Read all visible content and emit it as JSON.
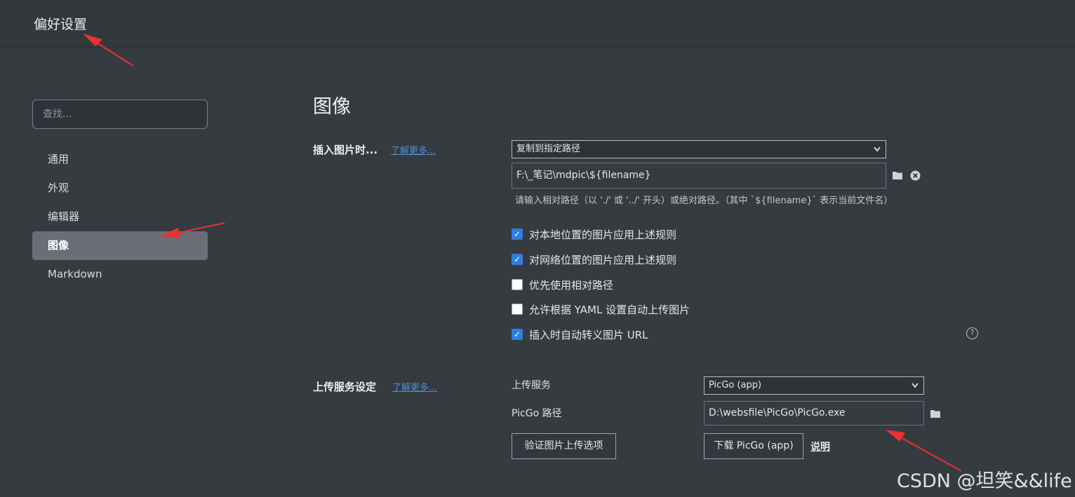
{
  "window": {
    "title": "偏好设置"
  },
  "sidebar": {
    "search_placeholder": "查找...",
    "items": [
      {
        "label": "通用",
        "active": false
      },
      {
        "label": "外观",
        "active": false
      },
      {
        "label": "编辑器",
        "active": false
      },
      {
        "label": "图像",
        "active": true
      },
      {
        "label": "Markdown",
        "active": false
      }
    ]
  },
  "main": {
    "title": "图像",
    "insert_section": {
      "label": "插入图片时...",
      "learn_more": "了解更多...",
      "select_value": "复制到指定路径",
      "path_value": "F:\\_笔记\\mdpic\\${filename}",
      "hint": "请输入相对路径（以 './' 或 '../' 开头）或绝对路径。（其中 `${filename}` 表示当前文件名）",
      "checkboxes": [
        {
          "label": "对本地位置的图片应用上述规则",
          "checked": true
        },
        {
          "label": "对网络位置的图片应用上述规则",
          "checked": true
        },
        {
          "label": "优先使用相对路径",
          "checked": false
        },
        {
          "label": "允许根据 YAML 设置自动上传图片",
          "checked": false
        },
        {
          "label": "插入时自动转义图片 URL",
          "checked": true
        }
      ],
      "help_glyph": "?"
    },
    "upload_section": {
      "label": "上传服务设定",
      "learn_more": "了解更多...",
      "service_label": "上传服务",
      "service_value": "PicGo (app)",
      "path_label": "PicGo 路径",
      "path_value": "D:\\websfile\\PicGo\\PicGo.exe",
      "verify_button": "验证图片上传选项",
      "download_button": "下载 PicGo (app)",
      "explain_link": "说明"
    }
  },
  "watermark": "CSDN @坦笑&&life",
  "colors": {
    "accent": "#2f7de1",
    "link": "#4a8fd9",
    "annotation_arrow": "#e8322f"
  }
}
